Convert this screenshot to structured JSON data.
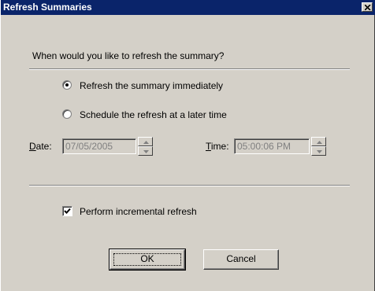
{
  "window": {
    "title": "Refresh Summaries",
    "close_icon": "close-icon"
  },
  "prompt": "When would you like to refresh the summary?",
  "options": [
    {
      "label": "Refresh the summary immediately",
      "selected": true
    },
    {
      "label": "Schedule the refresh at a later time",
      "selected": false
    }
  ],
  "date": {
    "label_key": "D",
    "label_rest": "ate:",
    "value": "07/05/2005",
    "enabled": false
  },
  "time": {
    "label_key": "T",
    "label_rest": "ime:",
    "value": "05:00:06 PM",
    "enabled": false
  },
  "incremental": {
    "label": "Perform incremental refresh",
    "checked": true
  },
  "buttons": {
    "ok": "OK",
    "cancel": "Cancel"
  },
  "colors": {
    "titlebar": "#0a246a",
    "face": "#d4d0c8",
    "disabled_text": "#808080"
  }
}
